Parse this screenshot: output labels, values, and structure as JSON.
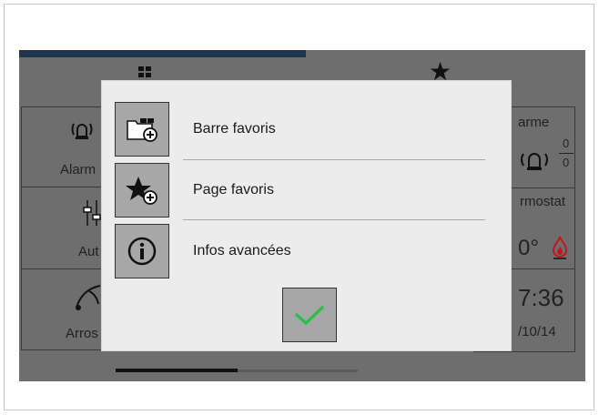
{
  "background_tiles": {
    "left": {
      "alarm_label": "Alarm",
      "automation_label": "Aut",
      "watering_label": "Arros"
    },
    "right": {
      "alarm_title": "arme",
      "alarm_count_top": "0",
      "alarm_count_bottom": "0",
      "thermostat_title": "rmostat",
      "thermostat_value": "0°",
      "clock_time": "7:36",
      "clock_date": "/10/14"
    }
  },
  "menu": {
    "items": [
      {
        "label": "Barre favoris",
        "icon": "folder-add-icon"
      },
      {
        "label": "Page favoris",
        "icon": "star-add-icon"
      },
      {
        "label": "Infos avancées",
        "icon": "info-icon"
      }
    ],
    "confirm_icon": "checkmark-icon"
  },
  "colors": {
    "accent_bar": "#1e3550",
    "confirm_check": "#2ebd4f",
    "flame": "#c0161c",
    "modal_bg": "#ececec",
    "button_bg": "#a7a7a7"
  }
}
